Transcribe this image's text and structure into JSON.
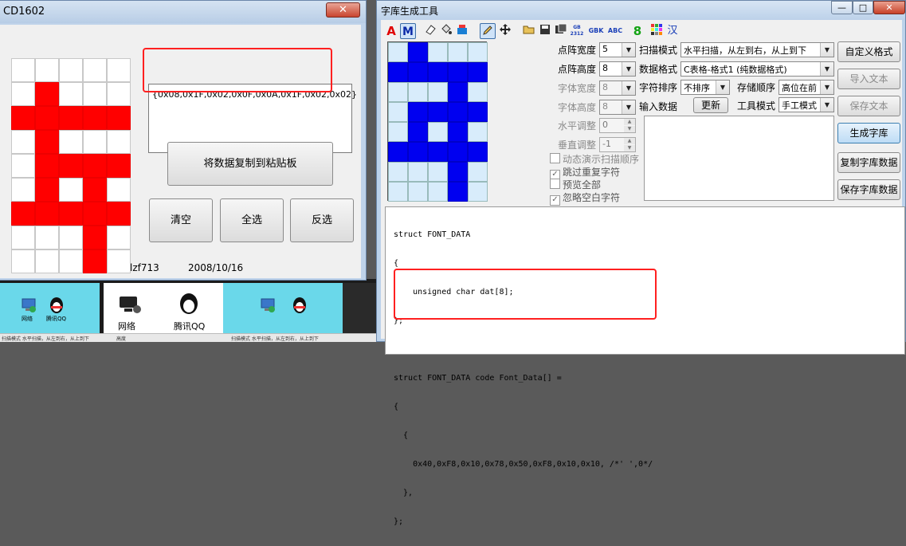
{
  "left_window": {
    "title": "CD1602",
    "close_glyph": "✕",
    "grid": [
      [
        0,
        0,
        0,
        0,
        0
      ],
      [
        0,
        1,
        0,
        0,
        0
      ],
      [
        1,
        1,
        1,
        1,
        1
      ],
      [
        0,
        1,
        0,
        0,
        0
      ],
      [
        0,
        1,
        1,
        1,
        1
      ],
      [
        0,
        1,
        0,
        1,
        0
      ],
      [
        1,
        1,
        1,
        1,
        1
      ],
      [
        0,
        0,
        0,
        1,
        0
      ],
      [
        0,
        0,
        0,
        1,
        0
      ]
    ],
    "data_text": "{0x08,0x1F,0x02,0x0F,0x0A,0x1F,0x02,0x02}",
    "copy_button": "将数据复制到粘贴板",
    "clear_button": "清空",
    "select_all_button": "全选",
    "invert_button": "反选",
    "author": "lzf713",
    "date": "2008/10/16"
  },
  "right_window": {
    "title": "字库生成工具",
    "window_buttons": {
      "minimize": "—",
      "maximize": "□",
      "close": "✕"
    },
    "toolbar": {
      "font_a": "A",
      "mode_m": "M",
      "gb2312": "GB 2312",
      "gbk": "GBK",
      "abc": "ABC",
      "eight": "8",
      "han": "汉"
    },
    "grid": [
      [
        0,
        1,
        0,
        0,
        0
      ],
      [
        1,
        1,
        1,
        1,
        1
      ],
      [
        0,
        0,
        0,
        1,
        0
      ],
      [
        0,
        1,
        1,
        1,
        1
      ],
      [
        0,
        1,
        0,
        1,
        0
      ],
      [
        1,
        1,
        1,
        1,
        1
      ],
      [
        0,
        0,
        0,
        1,
        0
      ],
      [
        0,
        0,
        0,
        1,
        0
      ]
    ],
    "settings": {
      "dot_width_label": "点阵宽度",
      "dot_width_value": "5",
      "dot_height_label": "点阵高度",
      "dot_height_value": "8",
      "font_width_label": "字体宽度",
      "font_width_value": "8",
      "font_height_label": "字体高度",
      "font_height_value": "8",
      "h_adjust_label": "水平调整",
      "h_adjust_value": "0",
      "v_adjust_label": "垂直调整",
      "v_adjust_value": "-1",
      "scan_mode_label": "扫描模式",
      "scan_mode_value": "水平扫描，从左到右，从上到下",
      "data_format_label": "数据格式",
      "data_format_value": "C表格-格式1 (纯数据格式)",
      "char_sort_label": "字符排序",
      "char_sort_value": "不排序",
      "store_order_label": "存储顺序",
      "store_order_value": "高位在前",
      "input_data_label": "输入数据",
      "update_button": "更新",
      "tool_mode_label": "工具模式",
      "tool_mode_value": "手工模式"
    },
    "checkboxes": {
      "animate_scan": "动态演示扫描顺序",
      "skip_duplicate": "跳过重复字符",
      "preview_all": "预览全部",
      "ignore_blank": "忽略空白字符"
    },
    "buttons": {
      "custom_format": "自定义格式",
      "import_text": "导入文本",
      "save_text": "保存文本",
      "generate": "生成字库",
      "copy_data": "复制字库数据",
      "save_data": "保存字库数据"
    },
    "code_lines": [
      "struct FONT_DATA",
      "{",
      "    unsigned char dat[8];",
      "};",
      "",
      "struct FONT_DATA code Font_Data[] =",
      "{",
      "  {",
      "    0x40,0xF8,0x10,0x78,0x50,0xF8,0x10,0x10, /*' ',0*/",
      "  },",
      "};"
    ]
  },
  "desktop": {
    "icon_network": "网络",
    "icon_qq": "腾讯QQ",
    "status_text_1": "扫描模式 水平扫描，从左到右，从上到下",
    "status_text_2": "高度",
    "status_text_3": "扫描模式 水平扫描，从左到右，从上到下"
  }
}
